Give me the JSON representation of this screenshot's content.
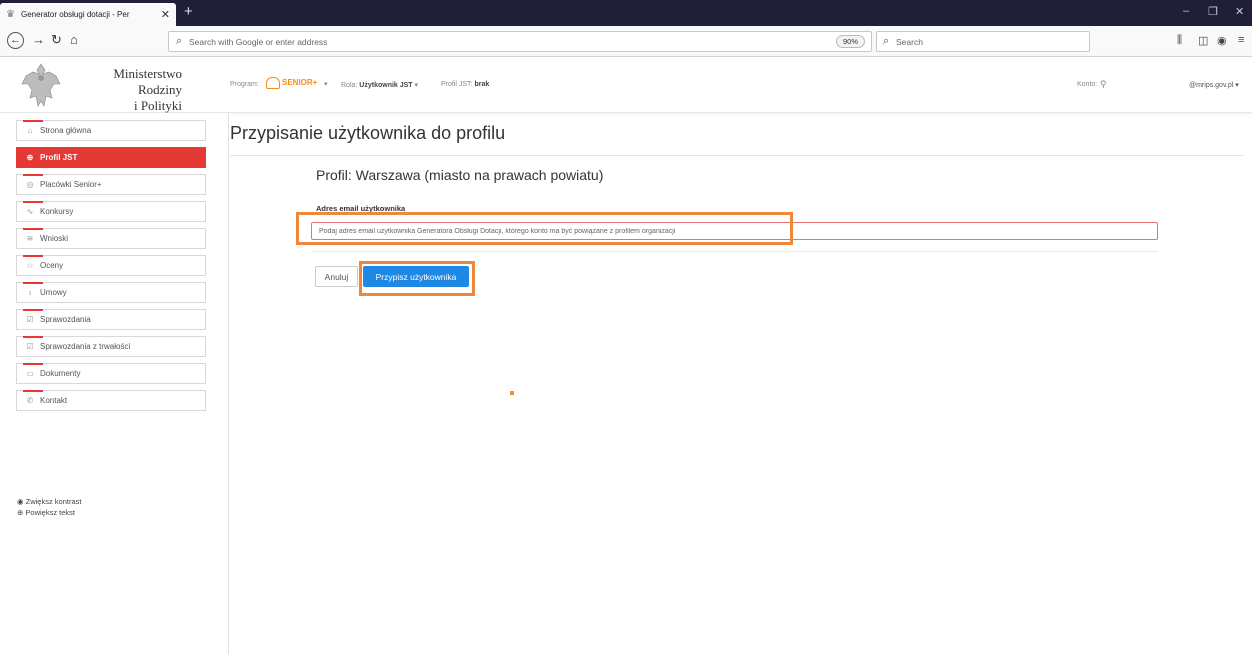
{
  "browser": {
    "tab_title": "Generator obsługi dotacji - Per",
    "url_placeholder": "Search with Google or enter address",
    "zoom": "90%",
    "search_placeholder": "Search"
  },
  "header": {
    "ministry_line1": "Ministerstwo Rodziny",
    "ministry_line2": "i Polityki Społecznej",
    "program_label": "Program:",
    "program_value": "SENIOR+",
    "role_label": "Rola:",
    "role_value": "Użytkownik JST",
    "profile_label": "Profil JST:",
    "profile_value": "brak",
    "account_label": "Konto:",
    "account_email": "@mrips.gov.pl"
  },
  "sidebar": {
    "items": [
      {
        "label": "Strona główna",
        "icon": "home-icon"
      },
      {
        "label": "Profil JST",
        "icon": "globe-icon"
      },
      {
        "label": "Placówki Senior+",
        "icon": "building-icon"
      },
      {
        "label": "Konkursy",
        "icon": "pulse-icon"
      },
      {
        "label": "Wnioski",
        "icon": "layers-icon"
      },
      {
        "label": "Oceny",
        "icon": "star-icon"
      },
      {
        "label": "Umowy",
        "icon": "award-icon"
      },
      {
        "label": "Sprawozdania",
        "icon": "checkbox-icon"
      },
      {
        "label": "Sprawozdania z trwałości",
        "icon": "checkbox-icon"
      },
      {
        "label": "Dokumenty",
        "icon": "folder-icon"
      },
      {
        "label": "Kontakt",
        "icon": "phone-icon"
      }
    ],
    "active_index": 1,
    "contrast": "Zwiększ kontrast",
    "bigger_text": "Powiększ tekst"
  },
  "main": {
    "title": "Przypisanie użytkownika do profilu",
    "profile": "Profil: Warszawa (miasto na prawach powiatu)",
    "email_label": "Adres email użytkownika",
    "email_placeholder": "Podaj adres email użytkownika Generatora Obsługi Dotacji, którego konto ma być powiązane z profilem organizacji",
    "cancel": "Anuluj",
    "assign": "Przypisz użytkownika"
  },
  "colors": {
    "accent_red": "#e53935",
    "primary_blue": "#1e88e5",
    "highlight_orange": "#f0883c"
  }
}
